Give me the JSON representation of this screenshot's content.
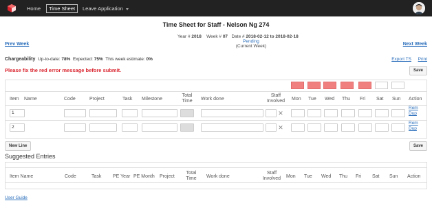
{
  "nav": {
    "home": "Home",
    "timesheet": "Time Sheet",
    "leave": "Leave Application"
  },
  "header": {
    "title": "Time Sheet for Staff - Nelson Ng 274",
    "year_label": "Year #",
    "year": "2018",
    "week_label": "Week #",
    "week": "07",
    "date_label": "Date #",
    "date_range": "2018-02-12 to 2018-02-18",
    "status": "Pending",
    "current_week": "(Current Week)",
    "prev_week": "Prev Week",
    "next_week": "Next Week"
  },
  "chargeability": {
    "label": "Chargeability",
    "uptodate_label": "Up-to-date:",
    "uptodate": "78%",
    "expected_label": "Expected:",
    "expected": "75%",
    "estimate_label": "This week estimate:",
    "estimate": "0%",
    "export": "Export TS",
    "print": "Print"
  },
  "error_message": "Please fix the red error message before submit.",
  "buttons": {
    "save": "Save",
    "new_line": "New Line"
  },
  "day_status": [
    {
      "day": "Mon",
      "error": true
    },
    {
      "day": "Tue",
      "error": true
    },
    {
      "day": "Wed",
      "error": true
    },
    {
      "day": "Thu",
      "error": true
    },
    {
      "day": "Fri",
      "error": true
    },
    {
      "day": "Sat",
      "error": false
    },
    {
      "day": "Sun",
      "error": false
    }
  ],
  "columns": {
    "item": "Item",
    "name": "Name",
    "code": "Code",
    "project": "Project",
    "task": "Task",
    "milestone": "Milestone",
    "total_time_1": "Total",
    "total_time_2": "Time",
    "work_done": "Work done",
    "staff_1": "Staff",
    "staff_2": "Involved",
    "mon": "Mon",
    "tue": "Tue",
    "wed": "Wed",
    "thu": "Thu",
    "fri": "Fri",
    "sat": "Sat",
    "sun": "Sun",
    "action": "Action"
  },
  "rows": [
    {
      "item": "1",
      "rem": "Rem",
      "dup": "Dup"
    },
    {
      "item": "2",
      "rem": "Rem",
      "dup": "Dup"
    }
  ],
  "suggested": {
    "title": "Suggested Entries",
    "columns": {
      "item_name": "Item Name",
      "code": "Code",
      "task": "Task",
      "pe_year": "PE Year",
      "pe_month": "PE Month",
      "project": "Project",
      "total_1": "Total",
      "total_2": "Time",
      "work_done": "Work done",
      "staff_1": "Staff",
      "staff_2": "Involved",
      "mon": "Mon",
      "tue": "Tue",
      "wed": "Wed",
      "thu": "Thu",
      "fri": "Fri",
      "sat": "Sat",
      "sun": "Sun",
      "action": "Action"
    }
  },
  "footer": {
    "user_guide": "User Guide"
  },
  "icons": {
    "logo": "cube-logo-icon",
    "avatar": "user-avatar-icon",
    "remove_staff": "close-icon"
  },
  "colors": {
    "navbar": "#222222",
    "link": "#2a6ebb",
    "error": "#d9232d",
    "day_error": "#f08080"
  }
}
